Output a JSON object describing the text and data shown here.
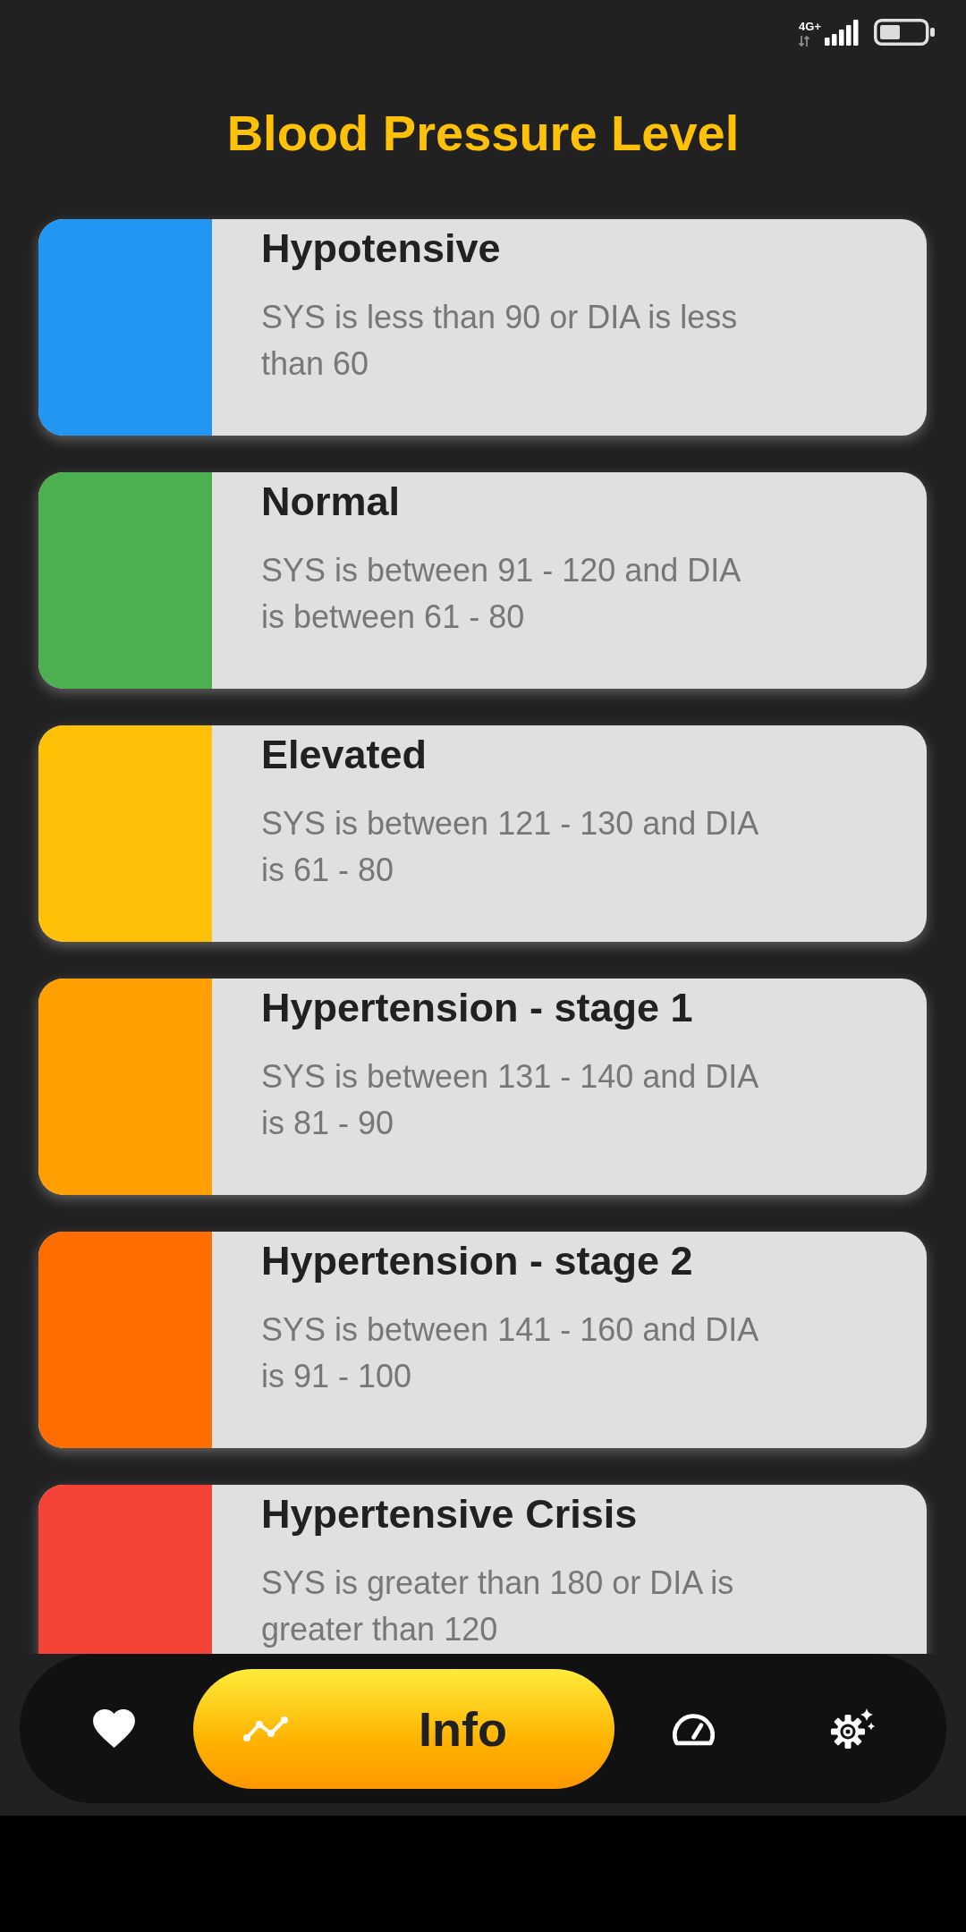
{
  "status_bar": {
    "network": "4G+"
  },
  "title": "Blood Pressure Level",
  "levels": [
    {
      "name": "Hypotensive",
      "description": "SYS is less than 90 or DIA is less than 60",
      "color": "#2196f3"
    },
    {
      "name": "Normal",
      "description": "SYS is between 91 - 120 and DIA is between 61 - 80",
      "color": "#4caf50"
    },
    {
      "name": "Elevated",
      "description": "SYS is between 121 - 130 and DIA is 61 - 80",
      "color": "#ffc107"
    },
    {
      "name": "Hypertension - stage 1",
      "description": "SYS is between 131 - 140 and DIA is 81 - 90",
      "color": "#ffa000"
    },
    {
      "name": "Hypertension - stage 2",
      "description": "SYS is between 141 - 160 and DIA is 91 - 100",
      "color": "#ff6d00"
    },
    {
      "name": "Hypertensive Crisis",
      "description": "SYS is greater than 180 or DIA is greater than 120",
      "color": "#f44336"
    }
  ],
  "nav": [
    {
      "kind": "favorites",
      "selected": false
    },
    {
      "kind": "trends",
      "selected": true,
      "label": "Info"
    },
    {
      "kind": "measure",
      "selected": false
    },
    {
      "kind": "settings",
      "selected": false
    }
  ]
}
